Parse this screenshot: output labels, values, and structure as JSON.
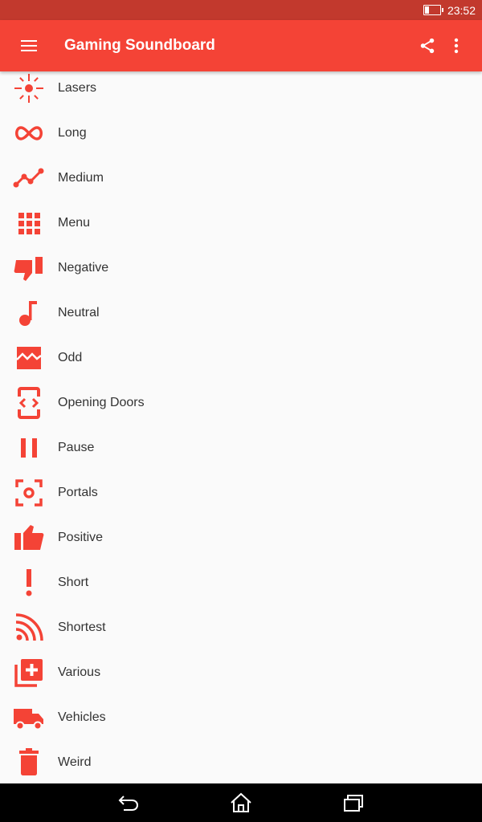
{
  "status_bar": {
    "time": "23:52",
    "battery_level": 0.2
  },
  "app_bar": {
    "title": "Gaming Soundboard",
    "menu_icon": "menu-icon",
    "share_icon": "share-icon",
    "more_icon": "more-vert-icon"
  },
  "accent_color": "#f44336",
  "items": [
    {
      "label": "Lasers",
      "icon": "flare-icon"
    },
    {
      "label": "Long",
      "icon": "all-inclusive-icon"
    },
    {
      "label": "Medium",
      "icon": "timeline-icon"
    },
    {
      "label": "Menu",
      "icon": "apps-icon"
    },
    {
      "label": "Negative",
      "icon": "thumb-down-icon"
    },
    {
      "label": "Neutral",
      "icon": "music-note-icon"
    },
    {
      "label": "Odd",
      "icon": "broken-image-icon"
    },
    {
      "label": "Opening Doors",
      "icon": "settings-ethernet-icon"
    },
    {
      "label": "Pause",
      "icon": "pause-icon"
    },
    {
      "label": "Portals",
      "icon": "center-focus-icon"
    },
    {
      "label": "Positive",
      "icon": "thumb-up-icon"
    },
    {
      "label": "Short",
      "icon": "priority-high-icon"
    },
    {
      "label": "Shortest",
      "icon": "rss-feed-icon"
    },
    {
      "label": "Various",
      "icon": "library-add-icon"
    },
    {
      "label": "Vehicles",
      "icon": "local-shipping-icon"
    },
    {
      "label": "Weird",
      "icon": "delete-icon"
    }
  ],
  "nav_bar": {
    "back": "back-icon",
    "home": "home-icon",
    "recents": "recents-icon"
  }
}
